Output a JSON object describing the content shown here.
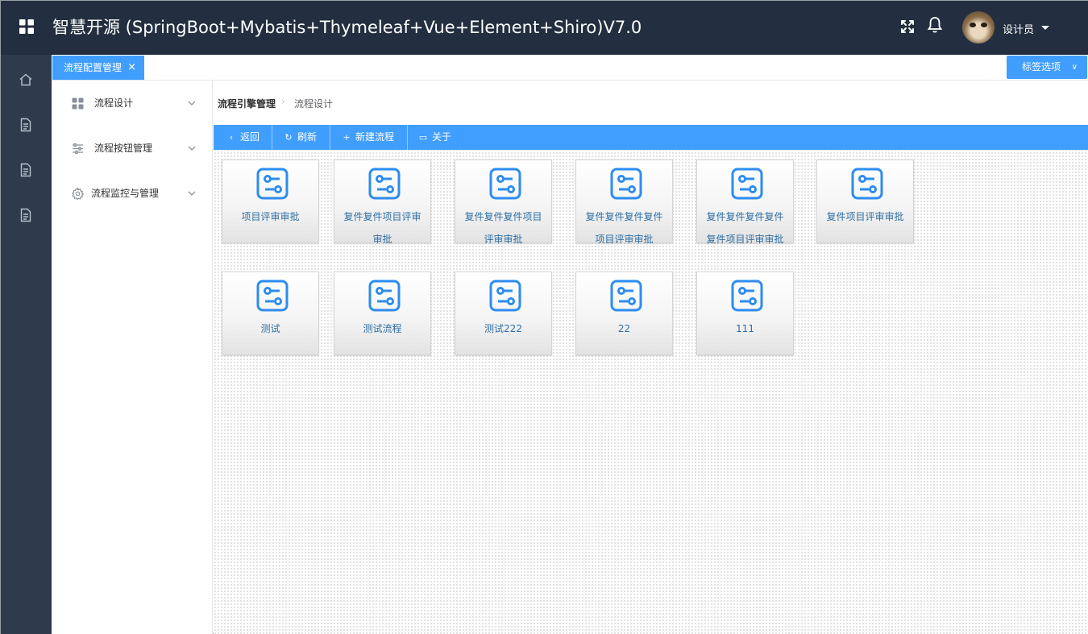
{
  "header": {
    "title": "智慧开源 (SpringBoot+Mybatis+Thymeleaf+Vue+Element+Shiro)V7.0",
    "user_name": "设计员",
    "icons": [
      "apps-grid-icon",
      "fullscreen-icon",
      "bell-icon",
      "caret-down-icon"
    ]
  },
  "rail": {
    "icons": [
      "home-icon",
      "document-icon",
      "document-icon",
      "document-icon"
    ]
  },
  "tabs": {
    "active_label": "流程配置管理",
    "close_glyph": "×",
    "options_label": "标签选项",
    "options_chevron": "∨"
  },
  "submenu": {
    "items": [
      {
        "label": "流程设计",
        "icon": "grid-icon"
      },
      {
        "label": "流程按钮管理",
        "icon": "sliders-icon"
      },
      {
        "label": "流程监控与管理",
        "icon": "gear-icon"
      }
    ]
  },
  "breadcrumb": {
    "root": "流程引擎管理",
    "separator": "›",
    "current": "流程设计"
  },
  "toolbar": {
    "back": {
      "label": "返回",
      "glyph": "‹"
    },
    "refresh": {
      "label": "刷新",
      "glyph": "↻"
    },
    "new_flow": {
      "label": "新建流程",
      "glyph": "+"
    },
    "about": {
      "label": "关于",
      "glyph": "▭"
    }
  },
  "cards": [
    {
      "label": "项目评审审批"
    },
    {
      "label": "复件复件项目评审审批"
    },
    {
      "label": "复件复件复件项目评审审批"
    },
    {
      "label": "复件复件复件复件项目评审审批"
    },
    {
      "label": "复件复件复件复件复件项目评审审批"
    },
    {
      "label": "复件项目评审审批"
    },
    {
      "label": "测试"
    },
    {
      "label": "测试流程"
    },
    {
      "label": "测试222"
    },
    {
      "label": "22"
    },
    {
      "label": "111"
    }
  ],
  "colors": {
    "header_bg": "#232f40",
    "rail_bg": "#2f3b4c",
    "accent": "#409eff",
    "card_icon": "#2d8cf0",
    "card_text": "#2f6fa3"
  }
}
